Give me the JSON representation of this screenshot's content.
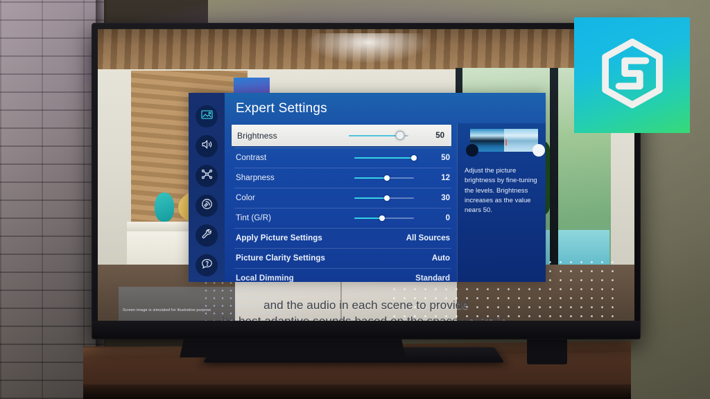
{
  "osd": {
    "title": "Expert Settings",
    "sidebar": [
      {
        "name": "picture-icon",
        "label": "Picture",
        "active": true
      },
      {
        "name": "sound-icon",
        "label": "Sound",
        "active": false
      },
      {
        "name": "network-icon",
        "label": "Network",
        "active": false
      },
      {
        "name": "broadcast-icon",
        "label": "Broadcast",
        "active": false
      },
      {
        "name": "general-icon",
        "label": "General",
        "active": false
      },
      {
        "name": "support-icon",
        "label": "Support",
        "active": false
      }
    ],
    "rows": [
      {
        "label": "Brightness",
        "value": "50",
        "type": "slider",
        "pct": 86,
        "selected": true
      },
      {
        "label": "Contrast",
        "value": "50",
        "type": "slider",
        "pct": 100,
        "selected": false
      },
      {
        "label": "Sharpness",
        "value": "12",
        "type": "slider",
        "pct": 55,
        "selected": false
      },
      {
        "label": "Color",
        "value": "30",
        "type": "slider",
        "pct": 55,
        "selected": false
      },
      {
        "label": "Tint (G/R)",
        "value": "0",
        "type": "slider",
        "pct": 46,
        "selected": false
      },
      {
        "label": "Apply Picture Settings",
        "value": "All Sources",
        "type": "value",
        "selected": false
      },
      {
        "label": "Picture Clarity Settings",
        "value": "Auto",
        "type": "value",
        "selected": false
      },
      {
        "label": "Local Dimming",
        "value": "Standard",
        "type": "value",
        "selected": false
      }
    ],
    "info": {
      "description": "Adjust the picture brightness by fine-tuning the levels. Brightness increases as the value nears 50."
    },
    "colors": {
      "header_blue": "#1a52a8",
      "body_blue": "#14409c",
      "sidebar_navy": "#143070",
      "accent_cyan": "#34d2e6",
      "selected_row_bg": "#f0f1ef"
    }
  },
  "caption": {
    "line1": "and the audio in each scene to provide",
    "line2": "he best adaptive sounds based on the space you're in."
  },
  "disclaimer": "Screen image is simulated for illustrative purpose",
  "logo": {
    "name": "hexagon-s-logo",
    "gradient_start": "#14b5e6",
    "gradient_end": "#37d977"
  }
}
